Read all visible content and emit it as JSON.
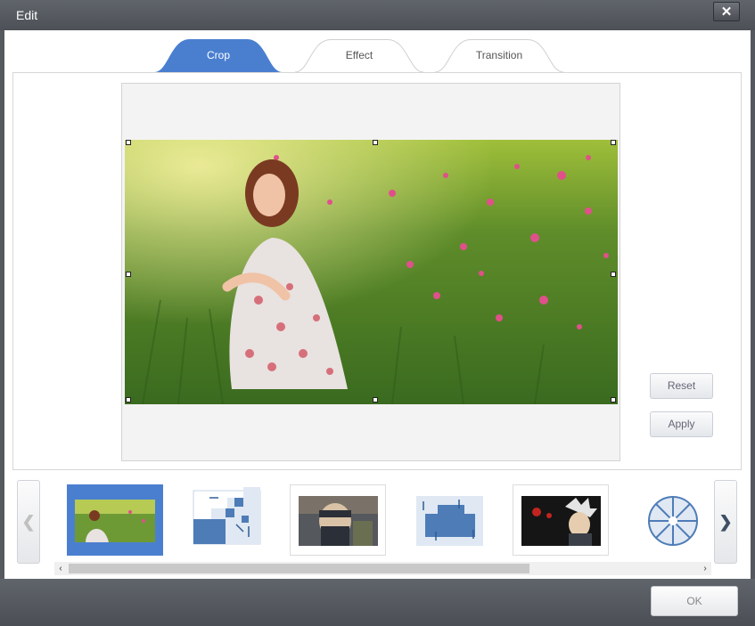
{
  "window": {
    "title": "Edit",
    "close_glyph": "✕"
  },
  "tabs": [
    {
      "label": "Crop",
      "active": true
    },
    {
      "label": "Effect",
      "active": false
    },
    {
      "label": "Transition",
      "active": false
    }
  ],
  "buttons": {
    "reset": "Reset",
    "apply": "Apply",
    "ok": "OK"
  },
  "strip": {
    "prev_glyph": "❮",
    "next_glyph": "❯",
    "thumbnails": [
      {
        "name": "photo-girl-flowers",
        "selected": true
      },
      {
        "name": "transition-arrows-in",
        "selected": false
      },
      {
        "name": "photo-anime-ninja",
        "selected": false
      },
      {
        "name": "transition-arrows-push",
        "selected": false
      },
      {
        "name": "photo-anime-red-eyes",
        "selected": false
      },
      {
        "name": "transition-radial",
        "selected": false
      }
    ],
    "scroll_left_glyph": "‹",
    "scroll_right_glyph": "›"
  },
  "colors": {
    "accent": "#4a7fd0",
    "titlebar": "#55595f"
  },
  "icons": [
    "close-icon",
    "chevron-left-icon",
    "chevron-right-icon"
  ]
}
